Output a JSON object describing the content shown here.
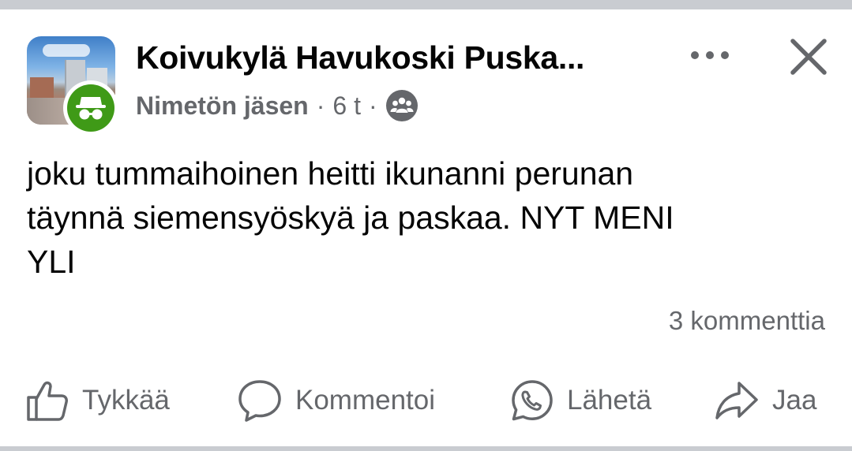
{
  "post": {
    "group_name": "Koivukylä Havukoski Puska...",
    "author": "Nimetön jäsen",
    "separator": "·",
    "time": "6 t",
    "text": "joku tummaihoinen heitti ikunanni perunan\ntäynnä siemensyöskyä ja paskaa. NYT MENI\nYLI",
    "comments_count": "3 kommenttia"
  },
  "icons": {
    "more": "more-horizontal-icon",
    "close": "close-icon",
    "anonymous": "anonymous-member-icon",
    "audience": "group-audience-icon",
    "like": "thumbs-up-icon",
    "comment": "comment-bubble-icon",
    "send": "messenger-whatsapp-icon",
    "share": "share-arrow-icon"
  },
  "actions": {
    "like_label": "Tykkää",
    "comment_label": "Kommentoi",
    "send_label": "Lähetä",
    "share_label": "Jaa"
  },
  "colors": {
    "text_primary": "#050505",
    "text_secondary": "#65676b",
    "anonymous_badge": "#3f9a17",
    "divider": "#c9ccd1"
  }
}
